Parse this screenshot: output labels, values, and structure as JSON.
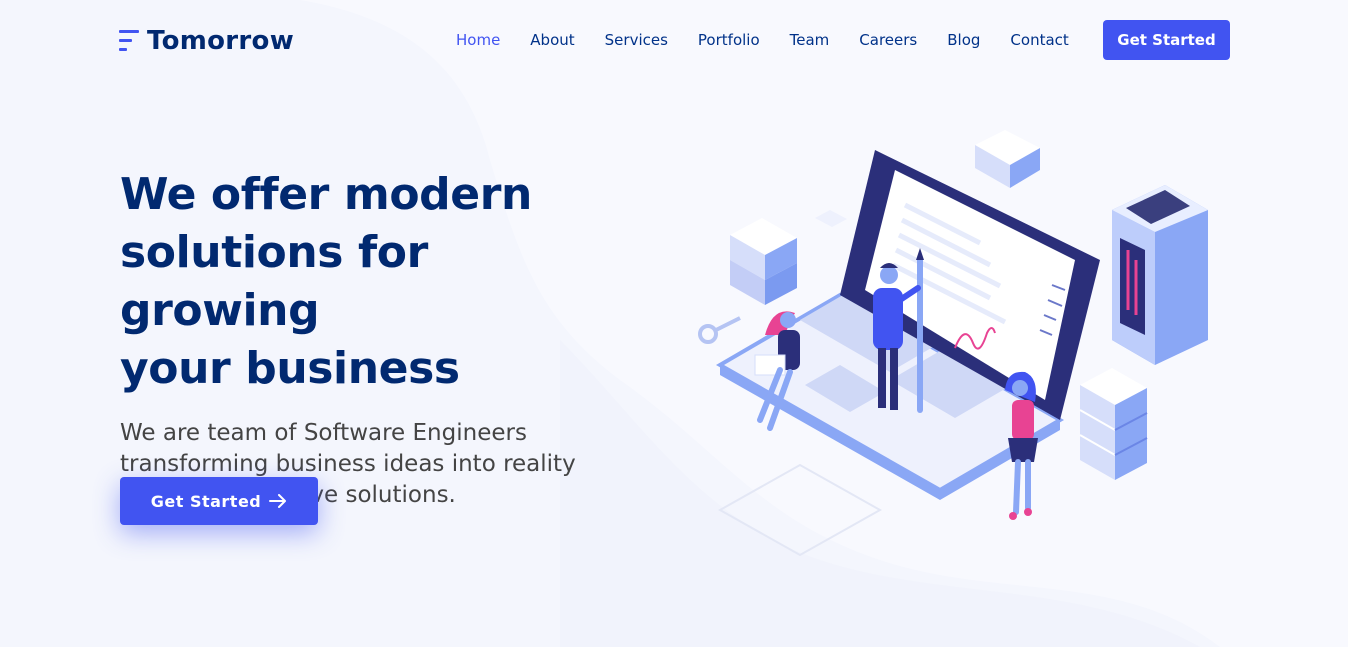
{
  "brand": {
    "name": "Tomorrow",
    "accent": "#4154f1",
    "dark": "#012970"
  },
  "nav": {
    "items": [
      {
        "label": "Home",
        "active": true
      },
      {
        "label": "About",
        "active": false
      },
      {
        "label": "Services",
        "active": false
      },
      {
        "label": "Portfolio",
        "active": false
      },
      {
        "label": "Team",
        "active": false
      },
      {
        "label": "Careers",
        "active": false
      },
      {
        "label": "Blog",
        "active": false
      },
      {
        "label": "Contact",
        "active": false
      }
    ],
    "cta_label": "Get Started"
  },
  "hero": {
    "title_line1": "We offer modern",
    "title_line2": "solutions for growing",
    "title_line3": "your business",
    "subtitle_line1": "We are team of Software Engineers",
    "subtitle_line2": "transforming business ideas into reality",
    "subtitle_line3": "through innovative solutions.",
    "cta_label": "Get Started",
    "cta_icon": "arrow-right-icon",
    "illustration": "isometric-laptop-team-illustration"
  }
}
